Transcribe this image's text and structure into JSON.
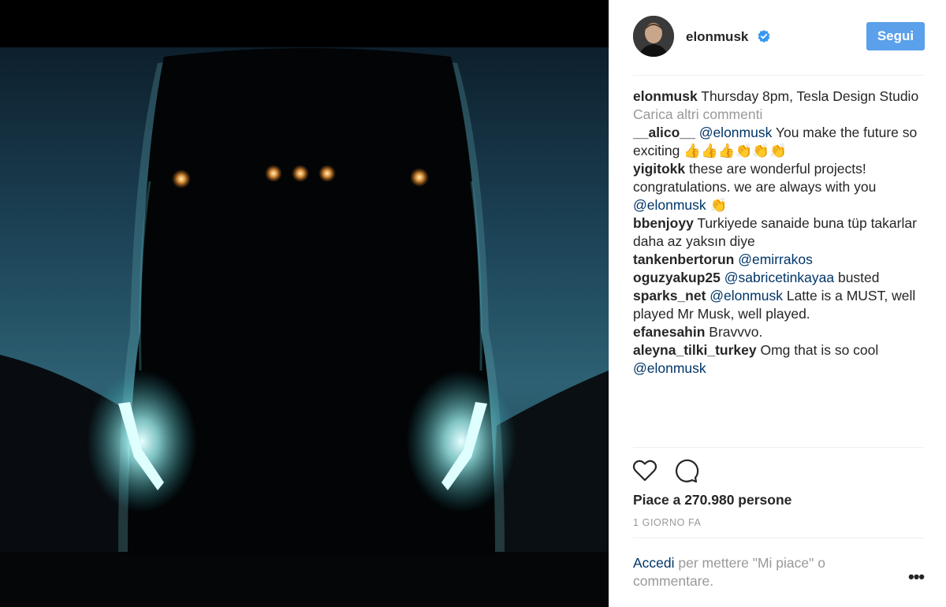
{
  "post": {
    "username": "elonmusk",
    "follow_label": "Segui",
    "caption_author": "elonmusk",
    "caption_text": " Thursday 8pm, Tesla Design Studio",
    "load_more": "Carica altri commenti",
    "likes_text": "Piace a 270.980 persone",
    "time_text": "1 GIORNO FA",
    "login_link": "Accedi",
    "login_text": " per mettere \"Mi piace\" o commentare.",
    "more_options": "•••"
  },
  "comments": [
    {
      "author": "__alico__",
      "parts": [
        {
          "mention": "@elonmusk"
        },
        {
          "text": " You make the future so exciting 👍👍👍👏👏👏"
        }
      ]
    },
    {
      "author": "yigitokk",
      "parts": [
        {
          "text": " these are wonderful projects! congratulations. we are always with you "
        },
        {
          "mention": "@elonmusk"
        },
        {
          "text": " 👏"
        }
      ]
    },
    {
      "author": "bbenjoyy",
      "parts": [
        {
          "text": " Turkiyede sanaide buna tüp takarlar daha az yaksın diye"
        }
      ]
    },
    {
      "author": "tankenbertorun",
      "parts": [
        {
          "mention": "@emirrakos"
        }
      ]
    },
    {
      "author": "oguzyakup25",
      "parts": [
        {
          "mention": "@sabricetinkayaa"
        },
        {
          "text": " busted"
        }
      ]
    },
    {
      "author": "sparks_net",
      "parts": [
        {
          "mention": "@elonmusk"
        },
        {
          "text": " Latte is a MUST, well played Mr Musk, well played."
        }
      ]
    },
    {
      "author": "efanesahin",
      "parts": [
        {
          "text": " Bravvvo."
        }
      ]
    },
    {
      "author": "aleyna_tilki_turkey",
      "parts": [
        {
          "text": " Omg that is so cool "
        },
        {
          "mention": "@elonmusk"
        }
      ]
    }
  ],
  "icons": {
    "like": "heart-icon",
    "comment": "comment-bubble-icon",
    "verified": "verified-badge-icon",
    "more": "more-options-icon"
  },
  "colors": {
    "follow_button": "#5aa0ea",
    "link": "#003569",
    "muted": "#999999",
    "verified": "#3897f0"
  }
}
